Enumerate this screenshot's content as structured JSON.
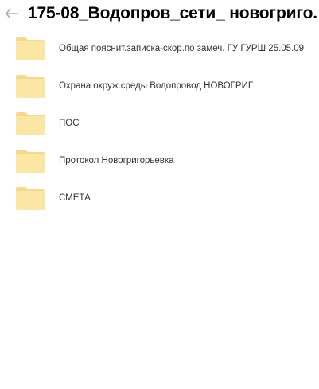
{
  "header": {
    "title": "175-08_Водопров_сети_ новогриго.",
    "back_icon": "arrow-left-icon"
  },
  "folders": [
    {
      "name": "Общая пояснит.записка-скор.по замеч. ГУ ГУРШ 25.05.09",
      "icon": "folder-icon"
    },
    {
      "name": "Охрана окруж.среды Водопровод НОВОГРИГ",
      "icon": "folder-icon"
    },
    {
      "name": "ПОС",
      "icon": "folder-icon"
    },
    {
      "name": "Протокол Новогригорьевка",
      "icon": "folder-icon"
    },
    {
      "name": "СМЕТА",
      "icon": "folder-icon"
    }
  ],
  "colors": {
    "folder_fill": "#fbe6a4",
    "folder_tab": "#f6d98a",
    "back_arrow": "#b0b0b0"
  }
}
